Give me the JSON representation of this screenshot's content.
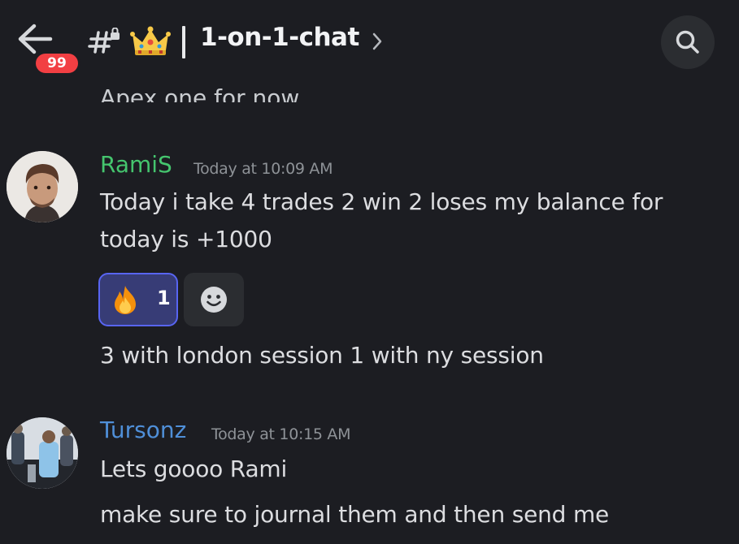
{
  "header": {
    "notification_count": "99",
    "channel_name": "1-on-1-chat",
    "icons": [
      "back-arrow-icon",
      "channel-hash-icon",
      "crown-icon",
      "chevron-right-icon",
      "search-icon"
    ]
  },
  "messages": {
    "previous_cutoff_text": "Apex one for now",
    "rami": {
      "author": "RamiS",
      "timestamp": "Today at 10:09 AM",
      "line1": "Today i take 4 trades 2 win 2 loses my balance for",
      "line2": "today is +1000",
      "reaction": {
        "emoji": "fire-icon",
        "count": "1"
      },
      "followup": "3 with london session 1 with ny session"
    },
    "tursonz": {
      "author": "Tursonz",
      "timestamp": "Today at 10:15 AM",
      "line1": "Lets goooo Rami",
      "line2": "make sure to journal them and then send me"
    }
  },
  "colors": {
    "background": "#1c1d22",
    "rami_name": "#45c56e",
    "tursonz_name": "#4f8fd8",
    "badge": "#f23f43",
    "reaction_bg": "#373c76",
    "reaction_border": "#5865f2"
  }
}
